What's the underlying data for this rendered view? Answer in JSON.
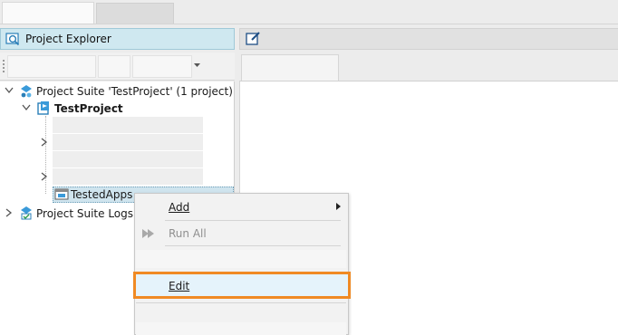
{
  "panel": {
    "title": "Project Explorer"
  },
  "tree": {
    "suite": "Project Suite 'TestProject' (1 project)",
    "project": "TestProject",
    "tested_apps": "TestedApps",
    "logs": "Project Suite Logs"
  },
  "menu": {
    "add": "Add",
    "run_all": "Run All",
    "edit": "Edit"
  },
  "colors": {
    "highlight": "#f08a24",
    "panel_header": "#cfe8f0"
  }
}
